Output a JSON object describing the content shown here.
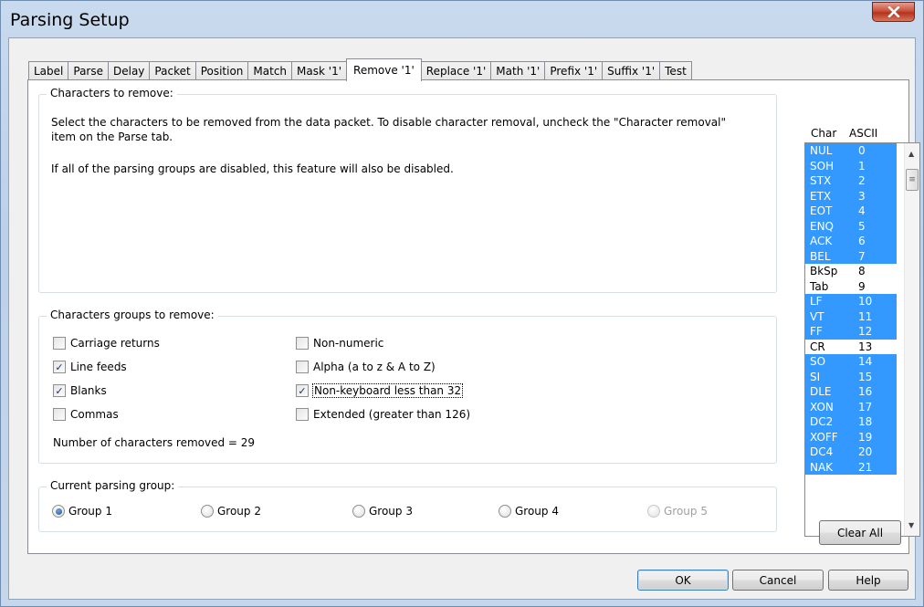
{
  "window": {
    "title": "Parsing Setup",
    "close_glyph": "X"
  },
  "tabs": [
    {
      "label": "Label"
    },
    {
      "label": "Parse"
    },
    {
      "label": "Delay"
    },
    {
      "label": "Packet"
    },
    {
      "label": "Position"
    },
    {
      "label": "Match"
    },
    {
      "label": "Mask '1'"
    },
    {
      "label": "Remove '1'",
      "active": true
    },
    {
      "label": "Replace '1'"
    },
    {
      "label": "Math '1'"
    },
    {
      "label": "Prefix '1'"
    },
    {
      "label": "Suffix '1'"
    },
    {
      "label": "Test"
    }
  ],
  "chars_to_remove": {
    "title": "Characters to remove:",
    "description_1": "Select the characters to be removed from the data packet.  To disable character removal, uncheck the \"Character removal\" item on the Parse tab.",
    "description_2": "If all of the parsing groups are disabled, this feature will also be disabled."
  },
  "groups_to_remove": {
    "title": "Characters groups to remove:",
    "checkboxes": [
      {
        "label": "Carriage returns",
        "checked": false
      },
      {
        "label": "Line feeds",
        "checked": true
      },
      {
        "label": "Blanks",
        "checked": true
      },
      {
        "label": "Commas",
        "checked": false
      },
      {
        "label": "Non-numeric",
        "checked": false
      },
      {
        "label": "Alpha (a to z & A to Z)",
        "checked": false
      },
      {
        "label": "Non-keyboard less than 32",
        "checked": true
      },
      {
        "label": "Extended (greater than 126)",
        "checked": false
      }
    ],
    "count_text": "Number of characters removed = 29"
  },
  "parsing_group": {
    "title": "Current parsing group:",
    "options": [
      {
        "label": "Group 1",
        "selected": true,
        "enabled": true
      },
      {
        "label": "Group 2",
        "selected": false,
        "enabled": true
      },
      {
        "label": "Group 3",
        "selected": false,
        "enabled": true
      },
      {
        "label": "Group 4",
        "selected": false,
        "enabled": true
      },
      {
        "label": "Group 5",
        "selected": false,
        "enabled": false
      }
    ]
  },
  "char_list": {
    "header_char": "Char",
    "header_ascii": "ASCII",
    "rows": [
      {
        "char": "NUL",
        "ascii": "0",
        "selected": true
      },
      {
        "char": "SOH",
        "ascii": "1",
        "selected": true
      },
      {
        "char": "STX",
        "ascii": "2",
        "selected": true
      },
      {
        "char": "ETX",
        "ascii": "3",
        "selected": true
      },
      {
        "char": "EOT",
        "ascii": "4",
        "selected": true
      },
      {
        "char": "ENQ",
        "ascii": "5",
        "selected": true
      },
      {
        "char": "ACK",
        "ascii": "6",
        "selected": true
      },
      {
        "char": "BEL",
        "ascii": "7",
        "selected": true
      },
      {
        "char": "BkSp",
        "ascii": "8",
        "selected": false
      },
      {
        "char": "Tab",
        "ascii": "9",
        "selected": false
      },
      {
        "char": "LF",
        "ascii": "10",
        "selected": true
      },
      {
        "char": "VT",
        "ascii": "11",
        "selected": true
      },
      {
        "char": "FF",
        "ascii": "12",
        "selected": true
      },
      {
        "char": "CR",
        "ascii": "13",
        "selected": false
      },
      {
        "char": "SO",
        "ascii": "14",
        "selected": true
      },
      {
        "char": "SI",
        "ascii": "15",
        "selected": true
      },
      {
        "char": "DLE",
        "ascii": "16",
        "selected": true
      },
      {
        "char": "XON",
        "ascii": "17",
        "selected": true
      },
      {
        "char": "DC2",
        "ascii": "18",
        "selected": true
      },
      {
        "char": "XOFF",
        "ascii": "19",
        "selected": true
      },
      {
        "char": "DC4",
        "ascii": "20",
        "selected": true
      },
      {
        "char": "NAK",
        "ascii": "21",
        "selected": true
      }
    ]
  },
  "buttons": {
    "clear_all": "Clear All",
    "ok": "OK",
    "cancel": "Cancel",
    "help": "Help"
  },
  "icons": {
    "scroll_up": "scroll-up-arrow-icon",
    "scroll_down": "scroll-down-arrow-icon",
    "check": "checkmark-icon"
  },
  "colors": {
    "selection": "#3399ff",
    "close_button": "#c9513c"
  }
}
